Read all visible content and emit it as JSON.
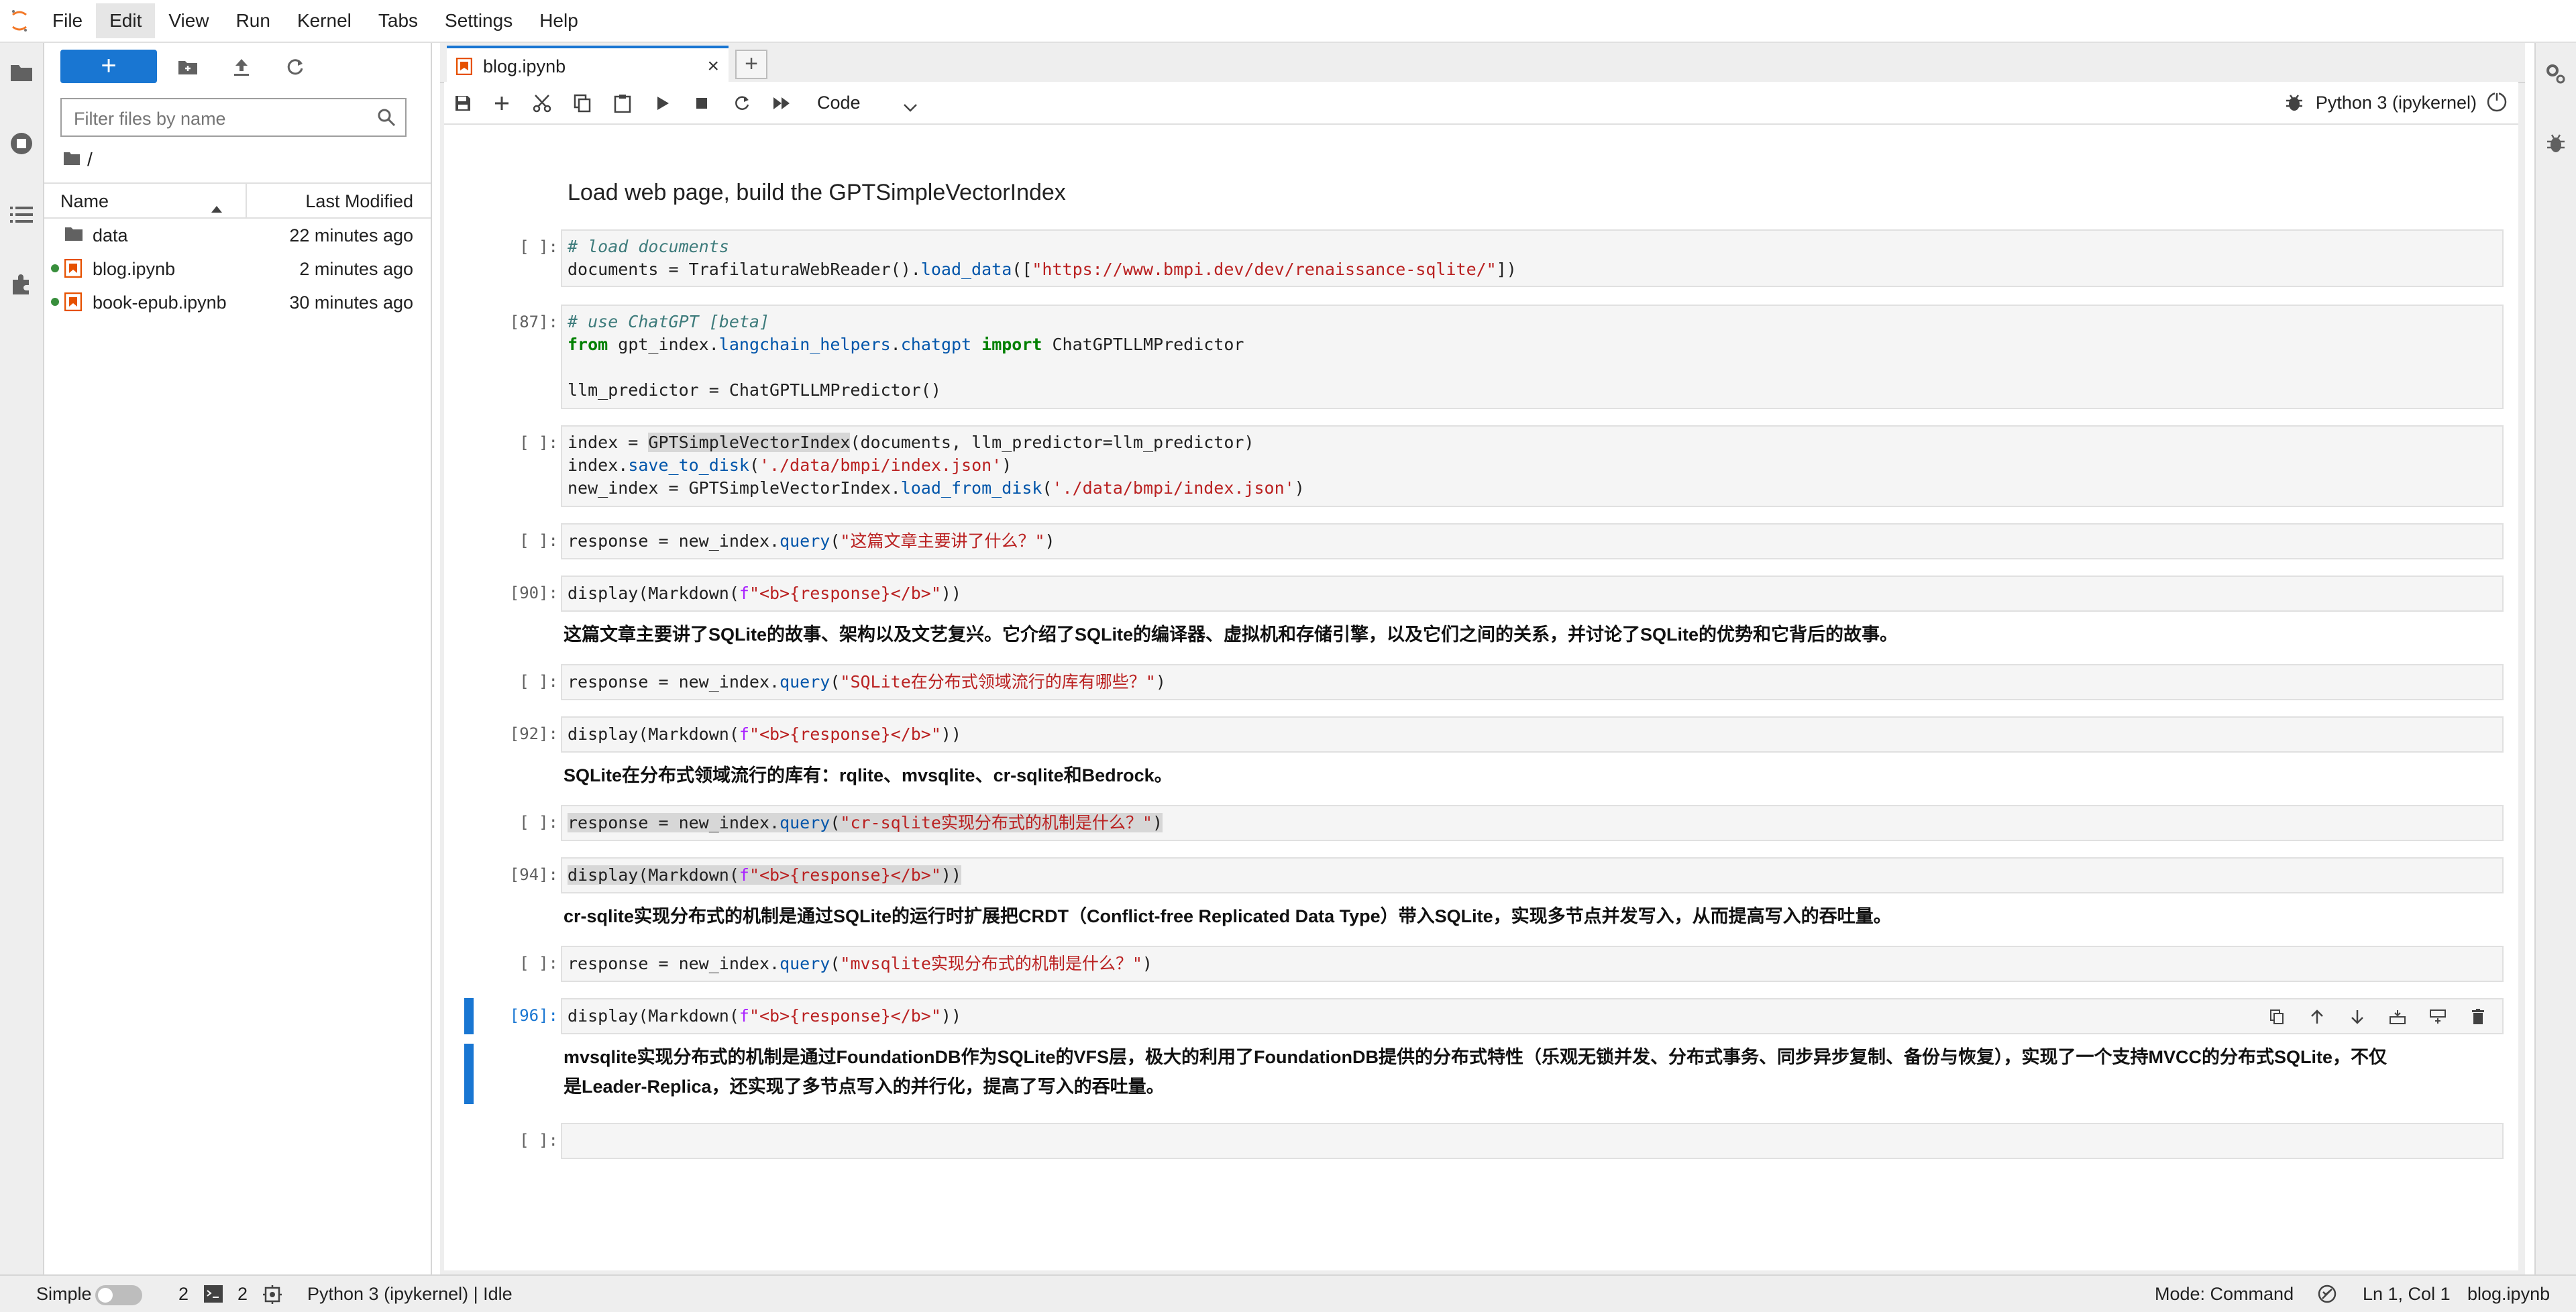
{
  "menubar": {
    "items": [
      "File",
      "Edit",
      "View",
      "Run",
      "Kernel",
      "Tabs",
      "Settings",
      "Help"
    ],
    "active": "Edit"
  },
  "filebrowser": {
    "new_launcher_label": "+",
    "filter_placeholder": "Filter files by name",
    "path": "/",
    "columns": {
      "name": "Name",
      "modified": "Last Modified"
    },
    "files": [
      {
        "name": "data",
        "modified": "22 minutes ago",
        "type": "folder",
        "running": false
      },
      {
        "name": "blog.ipynb",
        "modified": "2 minutes ago",
        "type": "notebook",
        "running": true
      },
      {
        "name": "book-epub.ipynb",
        "modified": "30 minutes ago",
        "type": "notebook",
        "running": true
      }
    ]
  },
  "tab": {
    "label": "blog.ipynb",
    "close": "×",
    "add": "+"
  },
  "toolbar": {
    "cell_type": "Code",
    "kernel": "Python 3 (ipykernel)"
  },
  "notebook": {
    "heading": "Load web page, build the GPTSimpleVectorIndex",
    "prompts": {
      "c1": "[ ]:",
      "c2": "[87]:",
      "c3": "[ ]:",
      "c4": "[ ]:",
      "c5": "[90]:",
      "c6": "[ ]:",
      "c7": "[92]:",
      "c8": "[ ]:",
      "c9": "[94]:",
      "c10": "[ ]:",
      "c11": "[96]:",
      "c12": "[ ]:"
    },
    "code": {
      "c1_l1": "# load documents",
      "c1_l2_a": "documents = TrafilaturaWebReader().",
      "c1_l2_fn": "load_data",
      "c1_l2_b": "([",
      "c1_l2_str": "\"https://www.bmpi.dev/dev/renaissance-sqlite/\"",
      "c1_l2_c": "])",
      "c2_l1": "# use ChatGPT [beta]",
      "c2_l2_from": "from",
      "c2_l2_mod": " gpt_index.",
      "c2_l2_mod2": "langchain_helpers",
      "c2_l2_dot": ".",
      "c2_l2_mod3": "chatgpt",
      "c2_l2_import": " import",
      "c2_l2_name": " ChatGPTLLMPredictor",
      "c2_l4": "llm_predictor = ChatGPTLLMPredictor()",
      "c3_l1_a": "index = ",
      "c3_l1_hl": "GPTSimpleVectorIndex",
      "c3_l1_b": "(documents, llm_predictor=llm_predictor)",
      "c3_l2_a": "index.",
      "c3_l2_fn": "save_to_disk",
      "c3_l2_b": "(",
      "c3_l2_str": "'./data/bmpi/index.json'",
      "c3_l2_c": ")",
      "c3_l3_a": "new_index = GPTSimpleVectorIndex.",
      "c3_l3_fn": "load_from_disk",
      "c3_l3_b": "(",
      "c3_l3_str": "'./data/bmpi/index.json'",
      "c3_l3_c": ")",
      "c4_a": "response = new_index.",
      "c4_fn": "query",
      "c4_b": "(",
      "c4_str": "\"这篇文章主要讲了什么？\"",
      "c4_c": ")",
      "c5_a": "display(Markdown(",
      "c5_f": "f",
      "c5_str": "\"<b>{response}</b>\"",
      "c5_c": "))",
      "c6_a": "response = new_index.",
      "c6_fn": "query",
      "c6_b": "(",
      "c6_str": "\"SQLite在分布式领域流行的库有哪些？\"",
      "c6_c": ")",
      "c7_a": "display(Markdown(",
      "c7_f": "f",
      "c7_str": "\"<b>{response}</b>\"",
      "c7_c": "))",
      "c8_a": "response = new_index.",
      "c8_fn": "query",
      "c8_b": "(",
      "c8_str": "\"cr-sqlite实现分布式的机制是什么？\"",
      "c8_c": ")",
      "c9_a": "display(Markdown(",
      "c9_f": "f",
      "c9_str": "\"<b>{response}</b>\"",
      "c9_c": "))",
      "c10_a": "response = new_index.",
      "c10_fn": "query",
      "c10_b": "(",
      "c10_str": "\"mvsqlite实现分布式的机制是什么？\"",
      "c10_c": ")",
      "c11_a": "display(Markdown(",
      "c11_f": "f",
      "c11_str": "\"<b>{response}</b>\"",
      "c11_c": "))"
    },
    "outputs": {
      "o5": "这篇文章主要讲了SQLite的故事、架构以及文艺复兴。它介绍了SQLite的编译器、虚拟机和存储引擎，以及它们之间的关系，并讨论了SQLite的优势和它背后的故事。",
      "o7": "SQLite在分布式领域流行的库有：rqlite、mvsqlite、cr-sqlite和Bedrock。",
      "o9": "cr-sqlite实现分布式的机制是通过SQLite的运行时扩展把CRDT（Conflict-free Replicated Data Type）带入SQLite，实现多节点并发写入，从而提高写入的吞吐量。",
      "o11_l1": "mvsqlite实现分布式的机制是通过FoundationDB作为SQLite的VFS层，极大的利用了FoundationDB提供的分布式特性（乐观无锁并发、分布式事务、同步异步复制、备份与恢复），实现了一个支持MVCC的分布式SQLite，不仅",
      "o11_l2": "是Leader-Replica，还实现了多节点写入的并行化，提高了写入的吞吐量。"
    }
  },
  "statusbar": {
    "mode_label": "Simple",
    "terminals_count": "2",
    "kernels_count": "2",
    "kernel_status": "Python 3 (ipykernel) | Idle",
    "mode": "Mode: Command",
    "cursor": "Ln 1, Col 1",
    "file": "blog.ipynb"
  },
  "colors": {
    "accent": "#1976d2",
    "running_dot": "#388e3c",
    "notebook_icon": "#e65100"
  }
}
